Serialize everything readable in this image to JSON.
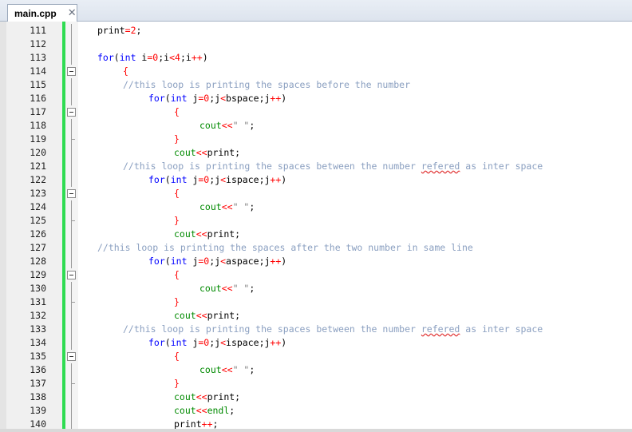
{
  "tab": {
    "title": "main.cpp",
    "close_glyph": "✕"
  },
  "colors": {
    "change_bar": "#2fdc52",
    "keyword": "#0000ff",
    "number": "#ff0000",
    "comment": "#8a9fc0",
    "identifier_green": "#008a00"
  },
  "lines": [
    {
      "n": "111",
      "indent": 4,
      "fold": "line",
      "tokens": [
        [
          "t",
          "print"
        ],
        [
          "o",
          "="
        ],
        [
          "n",
          "2"
        ],
        [
          "t",
          ";"
        ]
      ]
    },
    {
      "n": "112",
      "indent": 0,
      "fold": "line",
      "tokens": []
    },
    {
      "n": "113",
      "indent": 4,
      "fold": "line",
      "tokens": [
        [
          "k",
          "for"
        ],
        [
          "t",
          "("
        ],
        [
          "k",
          "int"
        ],
        [
          "t",
          " i"
        ],
        [
          "o",
          "="
        ],
        [
          "n",
          "0"
        ],
        [
          "t",
          ";i"
        ],
        [
          "o",
          "<"
        ],
        [
          "n",
          "4"
        ],
        [
          "t",
          ";i"
        ],
        [
          "o",
          "++"
        ],
        [
          "t",
          ")"
        ]
      ]
    },
    {
      "n": "114",
      "indent": 8,
      "fold": "box",
      "tokens": [
        [
          "o",
          "{"
        ]
      ]
    },
    {
      "n": "115",
      "indent": 8,
      "fold": "line",
      "tokens": [
        [
          "c",
          "//this loop is printing the spaces before the number"
        ]
      ]
    },
    {
      "n": "116",
      "indent": 12,
      "fold": "line",
      "tokens": [
        [
          "k",
          "for"
        ],
        [
          "t",
          "("
        ],
        [
          "k",
          "int"
        ],
        [
          "t",
          " j"
        ],
        [
          "o",
          "="
        ],
        [
          "n",
          "0"
        ],
        [
          "t",
          ";j"
        ],
        [
          "o",
          "<"
        ],
        [
          "t",
          "bspace;j"
        ],
        [
          "o",
          "++"
        ],
        [
          "t",
          ")"
        ]
      ]
    },
    {
      "n": "117",
      "indent": 16,
      "fold": "box",
      "tokens": [
        [
          "o",
          "{"
        ]
      ]
    },
    {
      "n": "118",
      "indent": 20,
      "fold": "line",
      "tokens": [
        [
          "f",
          "cout"
        ],
        [
          "o",
          "<<"
        ],
        [
          "s",
          "\" \""
        ],
        [
          "t",
          ";"
        ]
      ]
    },
    {
      "n": "119",
      "indent": 16,
      "fold": "end",
      "tokens": [
        [
          "o",
          "}"
        ]
      ]
    },
    {
      "n": "120",
      "indent": 16,
      "fold": "line",
      "tokens": [
        [
          "f",
          "cout"
        ],
        [
          "o",
          "<<"
        ],
        [
          "t",
          "print;"
        ]
      ]
    },
    {
      "n": "121",
      "indent": 8,
      "fold": "line",
      "tokens": [
        [
          "c",
          "//this loop is printing the spaces between the number "
        ],
        [
          "e",
          "refered"
        ],
        [
          "c",
          " as inter space"
        ]
      ]
    },
    {
      "n": "122",
      "indent": 12,
      "fold": "line",
      "tokens": [
        [
          "k",
          "for"
        ],
        [
          "t",
          "("
        ],
        [
          "k",
          "int"
        ],
        [
          "t",
          " j"
        ],
        [
          "o",
          "="
        ],
        [
          "n",
          "0"
        ],
        [
          "t",
          ";j"
        ],
        [
          "o",
          "<"
        ],
        [
          "t",
          "ispace;j"
        ],
        [
          "o",
          "++"
        ],
        [
          "t",
          ")"
        ]
      ]
    },
    {
      "n": "123",
      "indent": 16,
      "fold": "box",
      "tokens": [
        [
          "o",
          "{"
        ]
      ]
    },
    {
      "n": "124",
      "indent": 20,
      "fold": "line",
      "tokens": [
        [
          "f",
          "cout"
        ],
        [
          "o",
          "<<"
        ],
        [
          "s",
          "\" \""
        ],
        [
          "t",
          ";"
        ]
      ]
    },
    {
      "n": "125",
      "indent": 16,
      "fold": "end",
      "tokens": [
        [
          "o",
          "}"
        ]
      ]
    },
    {
      "n": "126",
      "indent": 16,
      "fold": "line",
      "tokens": [
        [
          "f",
          "cout"
        ],
        [
          "o",
          "<<"
        ],
        [
          "t",
          "print;"
        ]
      ]
    },
    {
      "n": "127",
      "indent": 4,
      "fold": "line",
      "tokens": [
        [
          "c",
          "//this loop is printing the spaces after the two number in same line"
        ]
      ]
    },
    {
      "n": "128",
      "indent": 12,
      "fold": "line",
      "tokens": [
        [
          "k",
          "for"
        ],
        [
          "t",
          "("
        ],
        [
          "k",
          "int"
        ],
        [
          "t",
          " j"
        ],
        [
          "o",
          "="
        ],
        [
          "n",
          "0"
        ],
        [
          "t",
          ";j"
        ],
        [
          "o",
          "<"
        ],
        [
          "t",
          "aspace;j"
        ],
        [
          "o",
          "++"
        ],
        [
          "t",
          ")"
        ]
      ]
    },
    {
      "n": "129",
      "indent": 16,
      "fold": "box",
      "tokens": [
        [
          "o",
          "{"
        ]
      ]
    },
    {
      "n": "130",
      "indent": 20,
      "fold": "line",
      "tokens": [
        [
          "f",
          "cout"
        ],
        [
          "o",
          "<<"
        ],
        [
          "s",
          "\" \""
        ],
        [
          "t",
          ";"
        ]
      ]
    },
    {
      "n": "131",
      "indent": 16,
      "fold": "end",
      "tokens": [
        [
          "o",
          "}"
        ]
      ]
    },
    {
      "n": "132",
      "indent": 16,
      "fold": "line",
      "tokens": [
        [
          "f",
          "cout"
        ],
        [
          "o",
          "<<"
        ],
        [
          "t",
          "print;"
        ]
      ]
    },
    {
      "n": "133",
      "indent": 8,
      "fold": "line",
      "tokens": [
        [
          "c",
          "//this loop is printing the spaces between the number "
        ],
        [
          "e",
          "refered"
        ],
        [
          "c",
          " as inter space"
        ]
      ]
    },
    {
      "n": "134",
      "indent": 12,
      "fold": "line",
      "tokens": [
        [
          "k",
          "for"
        ],
        [
          "t",
          "("
        ],
        [
          "k",
          "int"
        ],
        [
          "t",
          " j"
        ],
        [
          "o",
          "="
        ],
        [
          "n",
          "0"
        ],
        [
          "t",
          ";j"
        ],
        [
          "o",
          "<"
        ],
        [
          "t",
          "ispace;j"
        ],
        [
          "o",
          "++"
        ],
        [
          "t",
          ")"
        ]
      ]
    },
    {
      "n": "135",
      "indent": 16,
      "fold": "box",
      "tokens": [
        [
          "o",
          "{"
        ]
      ]
    },
    {
      "n": "136",
      "indent": 20,
      "fold": "line",
      "tokens": [
        [
          "f",
          "cout"
        ],
        [
          "o",
          "<<"
        ],
        [
          "s",
          "\" \""
        ],
        [
          "t",
          ";"
        ]
      ]
    },
    {
      "n": "137",
      "indent": 16,
      "fold": "end",
      "tokens": [
        [
          "o",
          "}"
        ]
      ]
    },
    {
      "n": "138",
      "indent": 16,
      "fold": "line",
      "tokens": [
        [
          "f",
          "cout"
        ],
        [
          "o",
          "<<"
        ],
        [
          "t",
          "print;"
        ]
      ]
    },
    {
      "n": "139",
      "indent": 16,
      "fold": "line",
      "tokens": [
        [
          "f",
          "cout"
        ],
        [
          "o",
          "<<"
        ],
        [
          "f",
          "endl"
        ],
        [
          "t",
          ";"
        ]
      ]
    },
    {
      "n": "140",
      "indent": 16,
      "fold": "line",
      "tokens": [
        [
          "t",
          "print"
        ],
        [
          "o",
          "++"
        ],
        [
          "t",
          ";"
        ]
      ]
    }
  ]
}
